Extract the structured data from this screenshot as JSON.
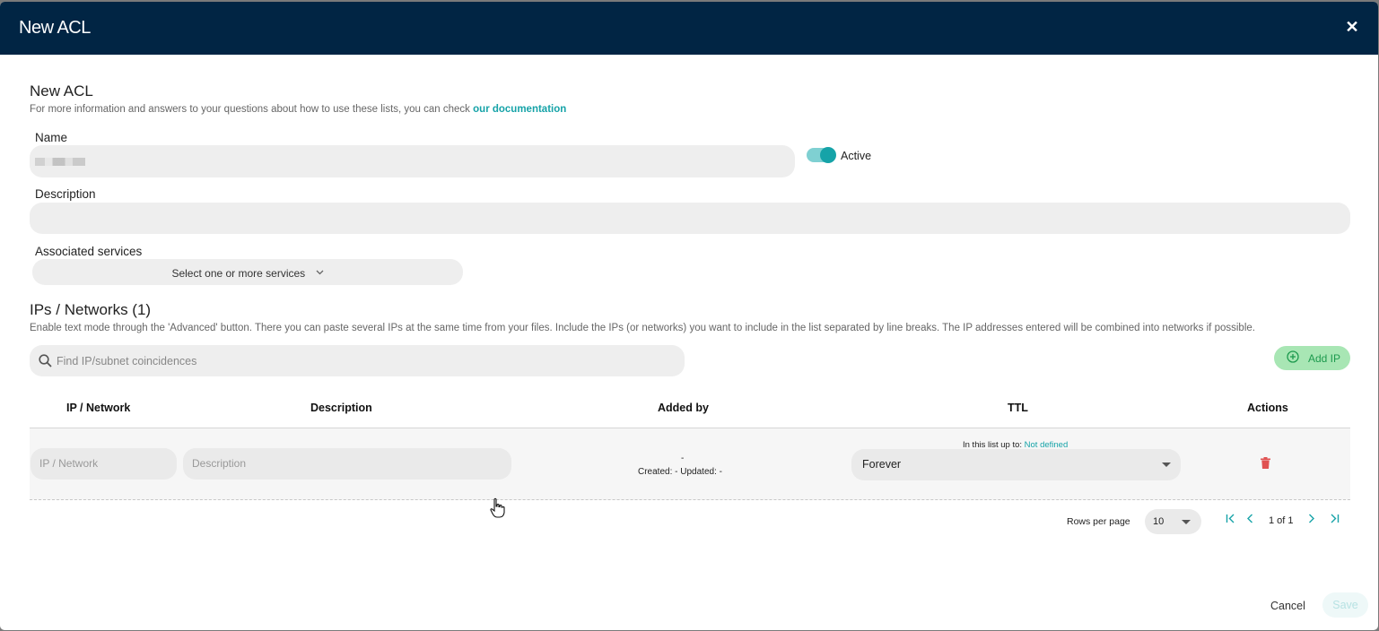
{
  "header": {
    "title": "New ACL"
  },
  "intro": {
    "title": "New ACL",
    "hint_text": "For more information and answers to your questions about how to use these lists, you can check",
    "doc_link": "our documentation"
  },
  "name_field": {
    "label": "Name",
    "value": ""
  },
  "active_toggle": {
    "label": "Active",
    "on": true
  },
  "description_field": {
    "label": "Description",
    "value": ""
  },
  "services": {
    "label": "Associated services",
    "placeholder": "Select one or more services"
  },
  "ips": {
    "title": "IPs / Networks (1)",
    "hint": "Enable text mode through the 'Advanced' button. There you can paste several IPs at the same time from your files. Include the IPs (or networks) you want to include in the list separated by line breaks. The IP addresses entered will be combined into networks if possible.",
    "search_placeholder": "Find IP/subnet coincidences",
    "add_label": "Add IP"
  },
  "table": {
    "columns": [
      "IP / Network",
      "Description",
      "Added by",
      "TTL",
      "Actions"
    ],
    "row": {
      "ip_placeholder": "IP / Network",
      "desc_placeholder": "Description",
      "added_by": "-",
      "created_label": "Created:",
      "created_value": "-",
      "updated_label": "Updated:",
      "updated_value": "-",
      "ttl_limit_label": "In this list up to:",
      "ttl_limit_value": "Not defined",
      "ttl_value": "Forever"
    }
  },
  "pagination": {
    "rows_label": "Rows per page",
    "rows_value": "10",
    "page_text": "1 of 1"
  },
  "footer": {
    "cancel": "Cancel",
    "save": "Save"
  },
  "colors": {
    "header_bg": "#012544",
    "accent": "#16a3a8",
    "delete": "#e05252",
    "add_bg": "#a8e6b4"
  }
}
